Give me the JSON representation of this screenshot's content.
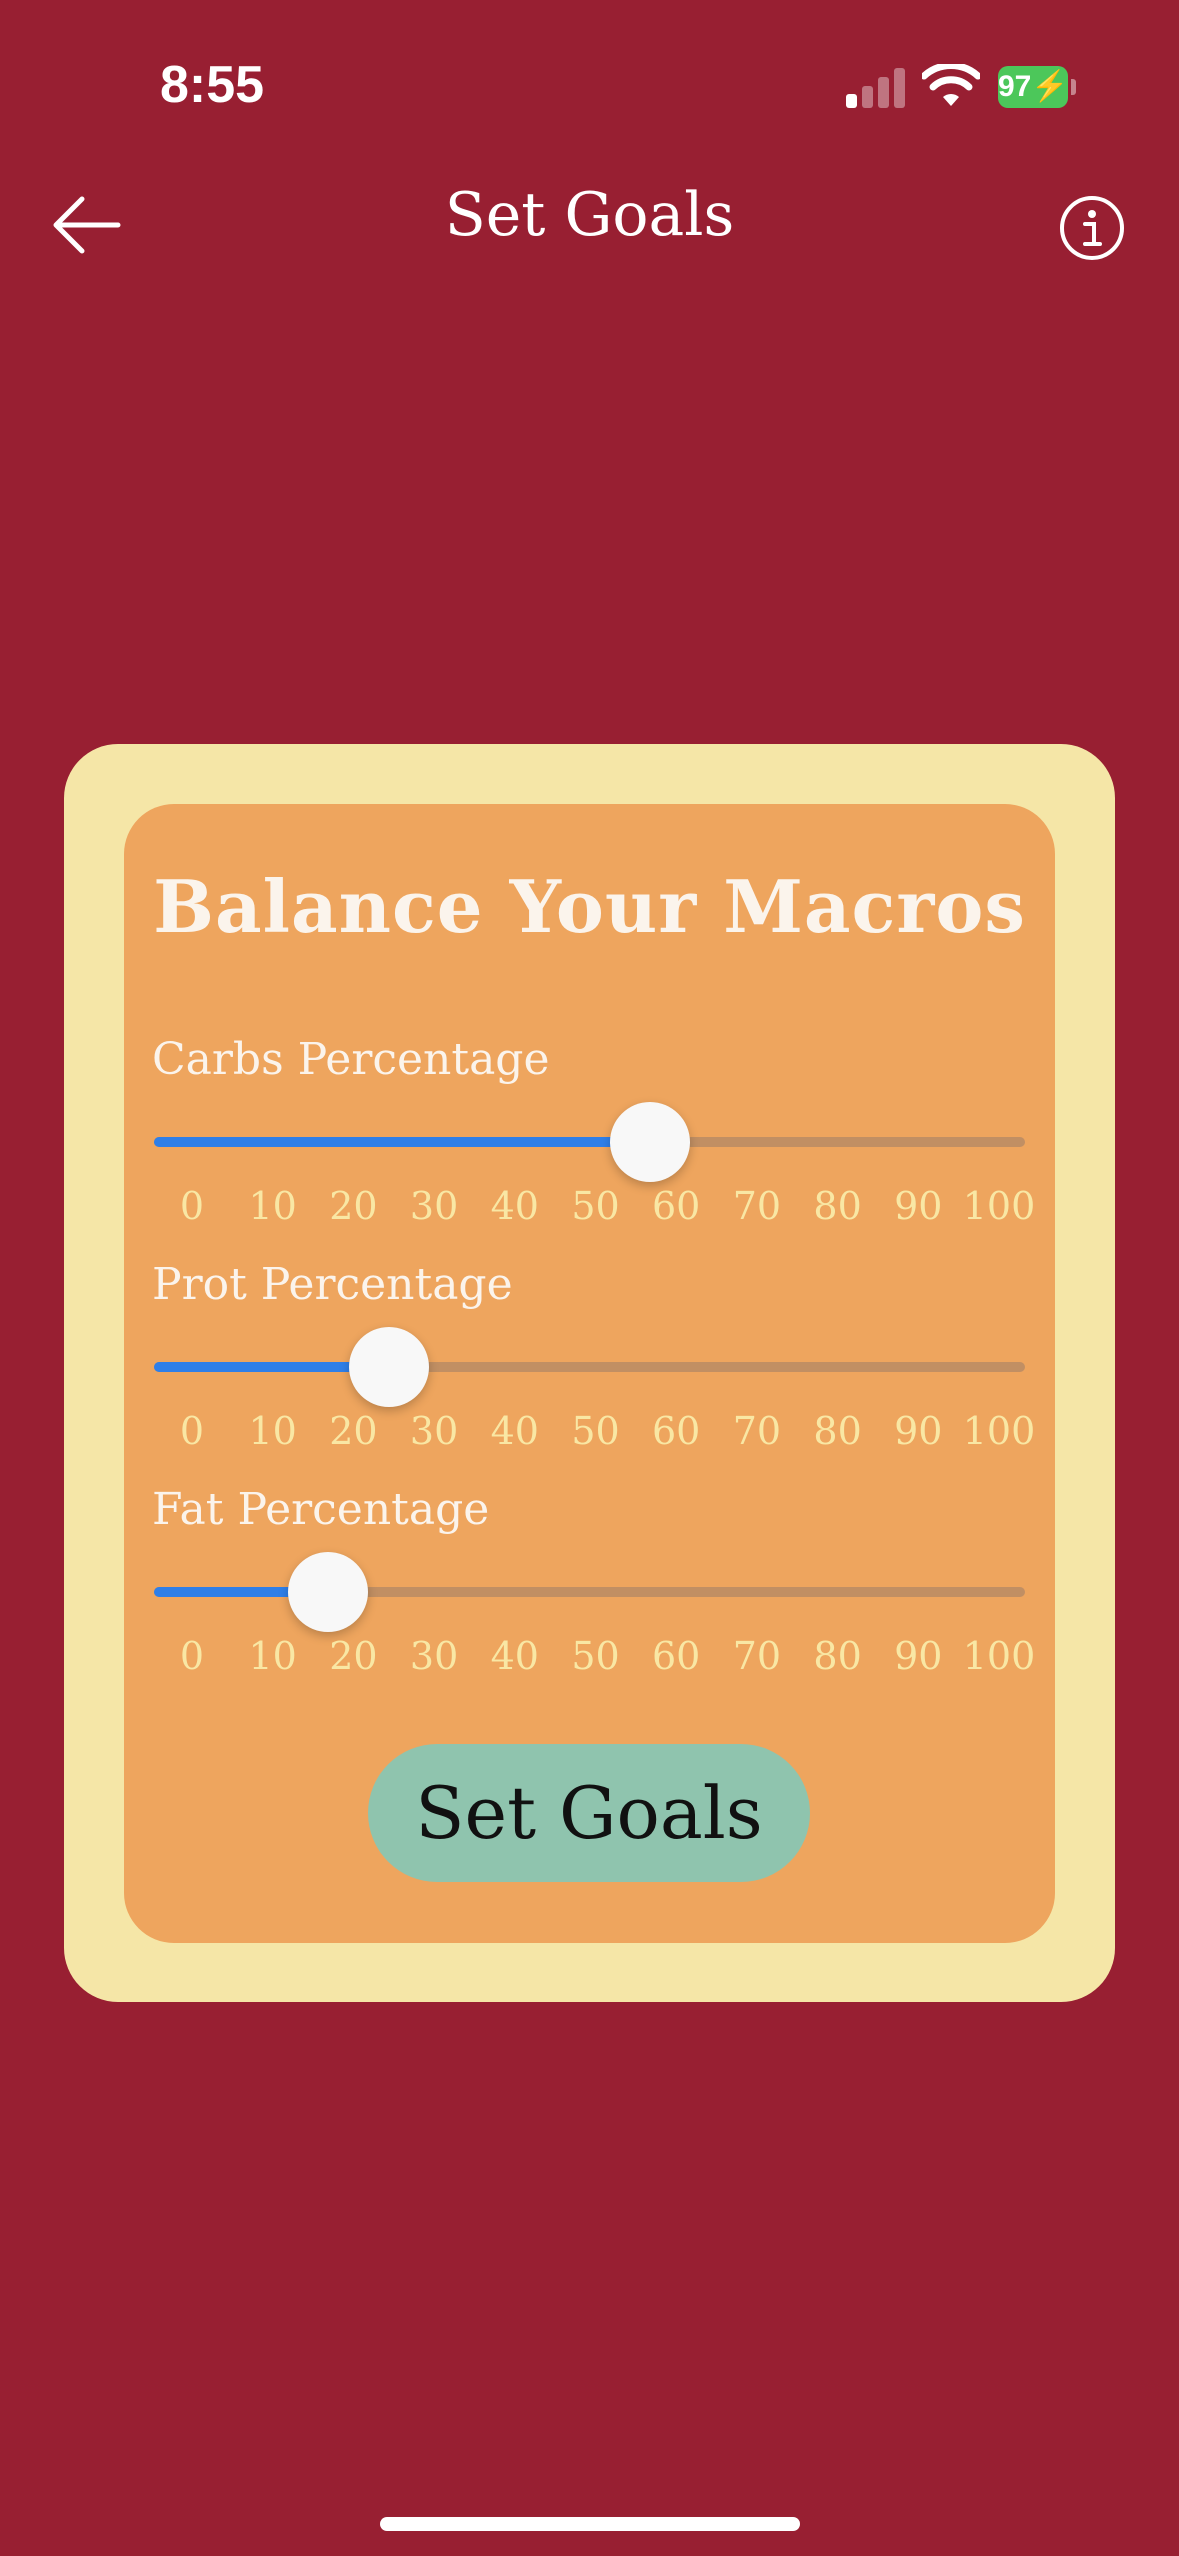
{
  "status_bar": {
    "time": "8:55",
    "battery_level": "97",
    "battery_color": "#4CC75A",
    "signal_bars_active": 1,
    "signal_bars_total": 4
  },
  "nav": {
    "title": "Set Goals",
    "back_icon": "arrow-left-icon",
    "info_icon": "info-circle-icon"
  },
  "card": {
    "title": "Balance Your Macros",
    "sliders": [
      {
        "label": "Carbs Percentage",
        "value": 57
      },
      {
        "label": "Prot Percentage",
        "value": 27
      },
      {
        "label": "Fat Percentage",
        "value": 20
      }
    ],
    "tick_labels": [
      "0",
      "10",
      "20",
      "30",
      "40",
      "50",
      "60",
      "70",
      "80",
      "90",
      "100"
    ],
    "button_label": "Set Goals"
  },
  "colors": {
    "background": "#981F32",
    "outer_card": "#F5E6A7",
    "inner_card": "#EEA55E",
    "slider_fill": "#2F7FE8",
    "button": "#8FC4AE"
  }
}
